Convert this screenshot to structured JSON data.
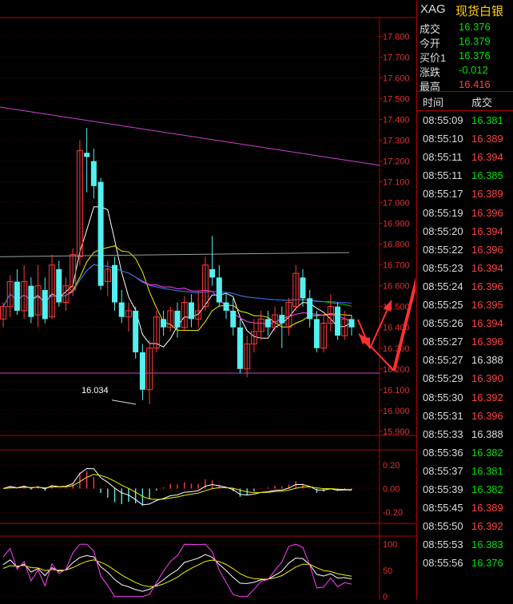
{
  "header": {
    "symbol": "XAG",
    "name": "现货白银"
  },
  "quote": [
    {
      "label": "成交",
      "value": "16.376",
      "color": "#00e000"
    },
    {
      "label": "今开",
      "value": "16.379",
      "color": "#00e000"
    },
    {
      "label": "买价1",
      "value": "16.376",
      "color": "#00e000"
    },
    {
      "label": "涨跌",
      "value": "-0.012",
      "color": "#00e000"
    },
    {
      "label": "最高",
      "value": "16.416",
      "color": "#ff4040"
    }
  ],
  "ticks_header": {
    "time": "时间",
    "price": "成交"
  },
  "ticks": [
    {
      "time": "08:55:09",
      "price": "16.381",
      "dir": "dn"
    },
    {
      "time": "08:55:10",
      "price": "16.389",
      "dir": "up"
    },
    {
      "time": "08:55:11",
      "price": "16.394",
      "dir": "up"
    },
    {
      "time": "08:55:11",
      "price": "16.385",
      "dir": "dn"
    },
    {
      "time": "08:55:17",
      "price": "16.389",
      "dir": "up"
    },
    {
      "time": "08:55:19",
      "price": "16.396",
      "dir": "up"
    },
    {
      "time": "08:55:20",
      "price": "16.394",
      "dir": "up"
    },
    {
      "time": "08:55:22",
      "price": "16.396",
      "dir": "up"
    },
    {
      "time": "08:55:23",
      "price": "16.394",
      "dir": "up"
    },
    {
      "time": "08:55:24",
      "price": "16.396",
      "dir": "up"
    },
    {
      "time": "08:55:25",
      "price": "16.395",
      "dir": "up"
    },
    {
      "time": "08:55:26",
      "price": "16.394",
      "dir": "up"
    },
    {
      "time": "08:55:27",
      "price": "16.396",
      "dir": "up"
    },
    {
      "time": "08:55:27",
      "price": "16.388",
      "dir": "wh"
    },
    {
      "time": "08:55:29",
      "price": "16.390",
      "dir": "up"
    },
    {
      "time": "08:55:30",
      "price": "16.392",
      "dir": "up"
    },
    {
      "time": "08:55:31",
      "price": "16.396",
      "dir": "up"
    },
    {
      "time": "08:55:33",
      "price": "16.388",
      "dir": "wh"
    },
    {
      "time": "08:55:36",
      "price": "16.382",
      "dir": "dn"
    },
    {
      "time": "08:55:37",
      "price": "16.381",
      "dir": "dn"
    },
    {
      "time": "08:55:39",
      "price": "16.382",
      "dir": "dn"
    },
    {
      "time": "08:55:45",
      "price": "16.389",
      "dir": "up"
    },
    {
      "time": "08:55:50",
      "price": "16.392",
      "dir": "up"
    },
    {
      "time": "08:55:53",
      "price": "16.383",
      "dir": "dn"
    },
    {
      "time": "08:55:56",
      "price": "16.376",
      "dir": "dn"
    }
  ],
  "chart_data": {
    "type": "candlestick",
    "price_axis": {
      "ticks": [
        "17.800",
        "17.700",
        "17.600",
        "17.500",
        "17.400",
        "17.300",
        "17.200",
        "17.100",
        "17.000",
        "16.900",
        "16.800",
        "16.700",
        "16.600",
        "16.500",
        "16.400",
        "16.300",
        "16.200",
        "16.100",
        "16.000",
        "15.900"
      ],
      "range": [
        15.88,
        17.86
      ]
    },
    "low_label": "16.034",
    "candles": [
      [
        16.44,
        16.5,
        16.4,
        16.52
      ],
      [
        16.5,
        16.62,
        16.45,
        16.65
      ],
      [
        16.62,
        16.48,
        16.46,
        16.68
      ],
      [
        16.48,
        16.62,
        16.44,
        16.7
      ],
      [
        16.6,
        16.45,
        16.42,
        16.64
      ],
      [
        16.46,
        16.6,
        16.4,
        16.7
      ],
      [
        16.58,
        16.44,
        16.42,
        16.64
      ],
      [
        16.45,
        16.7,
        16.44,
        16.75
      ],
      [
        16.68,
        16.52,
        16.5,
        16.72
      ],
      [
        16.52,
        16.6,
        16.48,
        16.64
      ],
      [
        16.58,
        16.75,
        16.55,
        16.78
      ],
      [
        16.74,
        17.25,
        16.7,
        17.3
      ],
      [
        17.24,
        17.22,
        17.05,
        17.36
      ],
      [
        17.2,
        17.08,
        17.02,
        17.26
      ],
      [
        17.1,
        16.6,
        16.58,
        17.12
      ],
      [
        16.62,
        16.68,
        16.55,
        16.72
      ],
      [
        16.7,
        16.52,
        16.48,
        16.74
      ],
      [
        16.52,
        16.45,
        16.42,
        16.58
      ],
      [
        16.45,
        16.48,
        16.38,
        16.52
      ],
      [
        16.48,
        16.28,
        16.25,
        16.5
      ],
      [
        16.28,
        16.1,
        16.05,
        16.32
      ],
      [
        16.1,
        16.3,
        16.03,
        16.34
      ],
      [
        16.3,
        16.45,
        16.28,
        16.48
      ],
      [
        16.44,
        16.4,
        16.36,
        16.48
      ],
      [
        16.4,
        16.48,
        16.38,
        16.5
      ],
      [
        16.48,
        16.4,
        16.35,
        16.52
      ],
      [
        16.4,
        16.52,
        16.38,
        16.55
      ],
      [
        16.52,
        16.44,
        16.4,
        16.56
      ],
      [
        16.44,
        16.48,
        16.4,
        16.58
      ],
      [
        16.5,
        16.7,
        16.48,
        16.74
      ],
      [
        16.68,
        16.64,
        16.6,
        16.84
      ],
      [
        16.64,
        16.52,
        16.5,
        16.7
      ],
      [
        16.52,
        16.48,
        16.44,
        16.56
      ],
      [
        16.48,
        16.4,
        16.36,
        16.54
      ],
      [
        16.4,
        16.2,
        16.18,
        16.44
      ],
      [
        16.2,
        16.32,
        16.16,
        16.36
      ],
      [
        16.32,
        16.38,
        16.28,
        16.44
      ],
      [
        16.38,
        16.44,
        16.34,
        16.48
      ],
      [
        16.44,
        16.4,
        16.36,
        16.48
      ],
      [
        16.4,
        16.46,
        16.38,
        16.5
      ],
      [
        16.46,
        16.42,
        16.3,
        16.5
      ],
      [
        16.4,
        16.52,
        16.36,
        16.54
      ],
      [
        16.5,
        16.66,
        16.48,
        16.7
      ],
      [
        16.64,
        16.54,
        16.5,
        16.68
      ],
      [
        16.54,
        16.44,
        16.4,
        16.58
      ],
      [
        16.44,
        16.3,
        16.28,
        16.48
      ],
      [
        16.3,
        16.42,
        16.28,
        16.46
      ],
      [
        16.42,
        16.5,
        16.38,
        16.56
      ],
      [
        16.5,
        16.36,
        16.34,
        16.52
      ],
      [
        16.36,
        16.44,
        16.34,
        16.48
      ],
      [
        16.44,
        16.4,
        16.36,
        16.46
      ]
    ],
    "macd_axis": {
      "ticks": [
        "0.20",
        "0.00",
        "-0.20"
      ],
      "range": [
        -0.26,
        0.28
      ]
    },
    "kdj_axis": {
      "ticks": [
        "100",
        "50",
        "0"
      ],
      "range": [
        -2,
        108
      ]
    }
  }
}
